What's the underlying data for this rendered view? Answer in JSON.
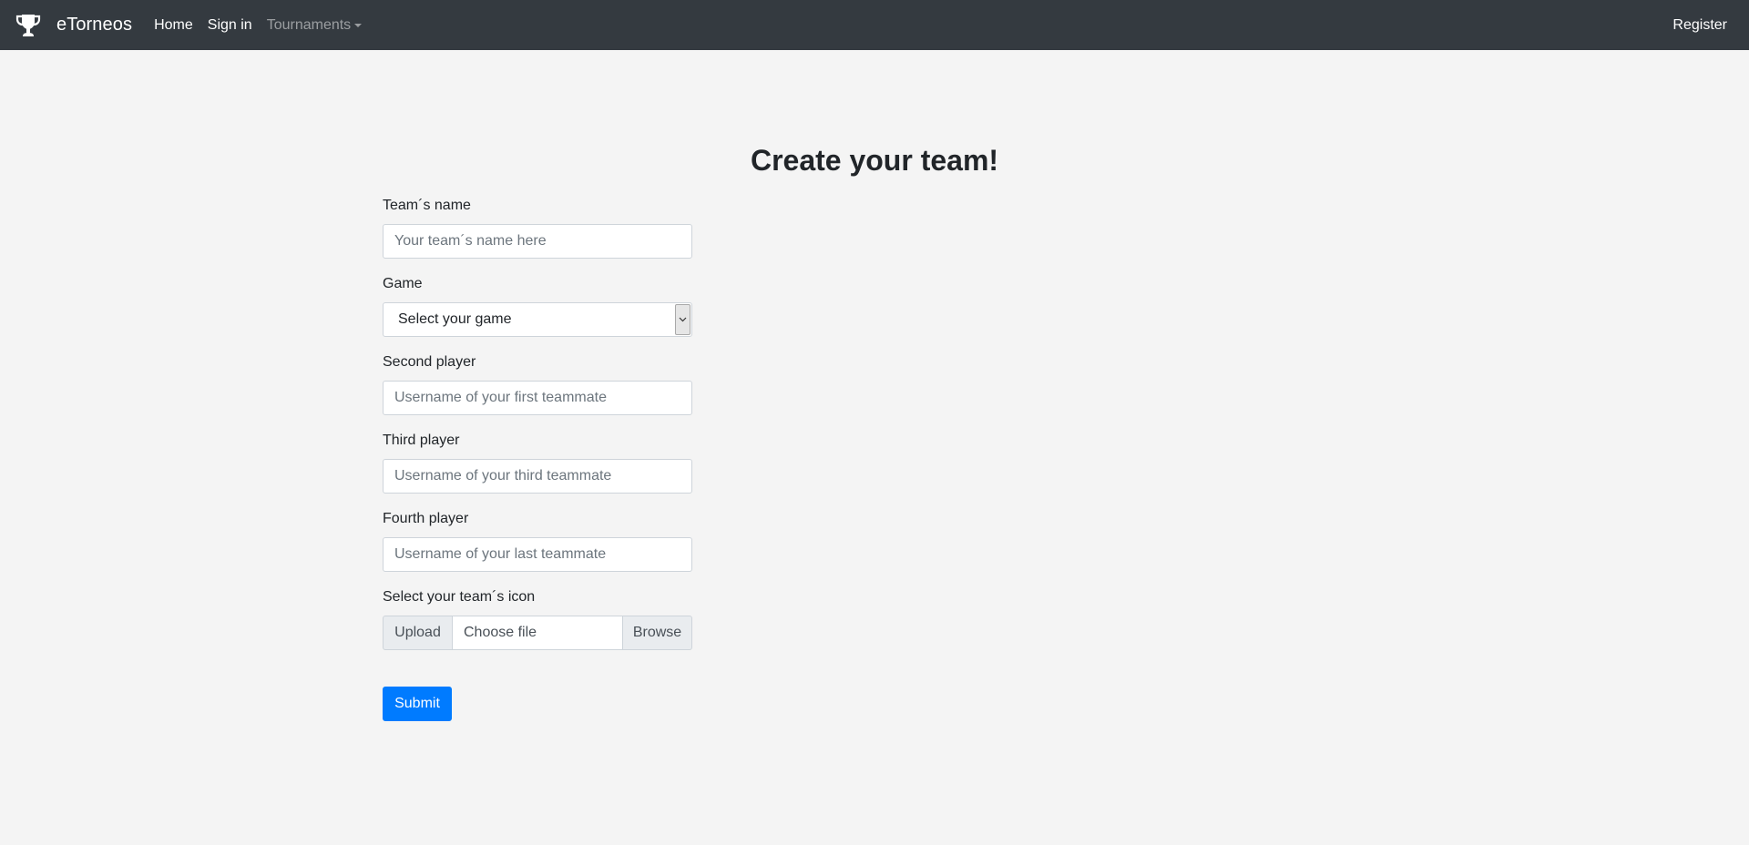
{
  "navbar": {
    "brand_icon": "trophy-icon",
    "brand": "eTorneos",
    "links": [
      "Home",
      "Sign in"
    ],
    "tournaments": "Tournaments",
    "register": "Register",
    "background_color": "#343a40"
  },
  "main": {
    "title": "Create your team!",
    "team_name": {
      "label": "Team´s name",
      "placeholder": "Your team´s name here"
    },
    "game": {
      "label": "Game",
      "selected": "Select your game"
    },
    "second_player": {
      "label": "Second player",
      "placeholder": "Username of your first teammate"
    },
    "third_player": {
      "label": "Third player",
      "placeholder": "Username of your third teammate"
    },
    "fourth_player": {
      "label": "Fourth player",
      "placeholder": "Username of your last teammate"
    },
    "icon_upload": {
      "label": "Select your team´s icon",
      "prepend": "Upload",
      "file_text": "Choose file",
      "browse": "Browse"
    },
    "submit": "Submit",
    "accent_color": "#007bff"
  }
}
